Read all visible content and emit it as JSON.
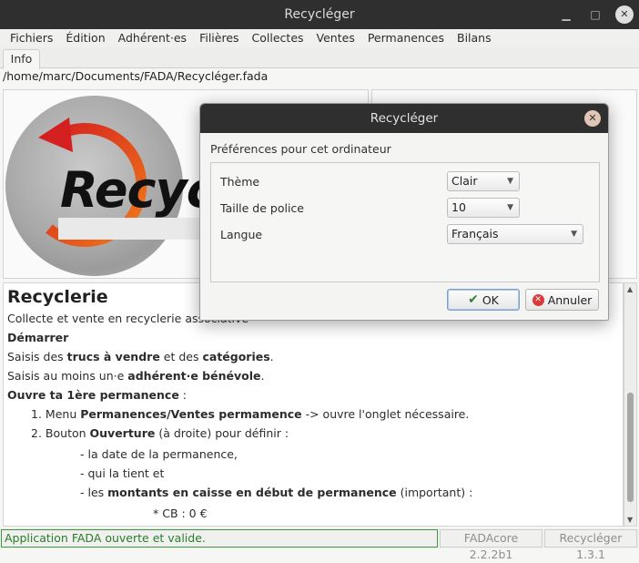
{
  "window": {
    "title": "Recycléger"
  },
  "menu": [
    "Fichiers",
    "Édition",
    "Adhérent·es",
    "Filières",
    "Collectes",
    "Ventes",
    "Permanences",
    "Bilans"
  ],
  "tabs": [
    {
      "label": "Info"
    }
  ],
  "file_path": "/home/marc/Documents/FADA/Recycléger.fada",
  "logo": {
    "text": "Recyc"
  },
  "content": {
    "title": "Recyclerie",
    "subtitle": "Collecte et vente en recyclerie associative",
    "start_heading": "Démarrer",
    "line1_pre": "Saisis des ",
    "line1_bold1": "trucs à vendre",
    "line1_mid": " et des ",
    "line1_bold2": "catégories",
    "line1_end": ".",
    "line2_pre": "Saisis au moins un·e ",
    "line2_bold": "adhérent·e bénévole",
    "line2_end": ".",
    "open_heading": "Ouvre ta 1ère permanence",
    "open_heading_end": " :",
    "step1_num": "1.",
    "step1_pre": "Menu ",
    "step1_bold": "Permanences/Ventes permamence",
    "step1_end": " -> ouvre l'onglet nécessaire.",
    "step2_num": "2.",
    "step2_pre": "Bouton ",
    "step2_bold": "Ouverture",
    "step2_end": " (à droite) pour définir :",
    "sub1": "- la date de la permanence,",
    "sub2": "- qui la tient et",
    "sub3_pre": "- les ",
    "sub3_bold": "montants en caisse en début de permanence",
    "sub3_end": " (important) :",
    "sub4": "* CB : 0 €"
  },
  "status": {
    "message": "Application FADA ouverte et valide.",
    "core_version": "FADAcore 2.2.2b1",
    "app_version": "Recycléger 1.3.1"
  },
  "dialog": {
    "title": "Recycléger",
    "subtitle": "Préférences pour cet ordinateur",
    "rows": [
      {
        "label": "Thème",
        "value": "Clair"
      },
      {
        "label": "Taille de police",
        "value": "10"
      },
      {
        "label": "Langue",
        "value": "Français"
      }
    ],
    "ok_label": "OK",
    "cancel_label": "Annuler"
  },
  "colors": {
    "status_ok": "#2a7d2a",
    "titlebar": "#2f2f2f",
    "logo_orange": "#e85a1c",
    "logo_red": "#d42020"
  }
}
